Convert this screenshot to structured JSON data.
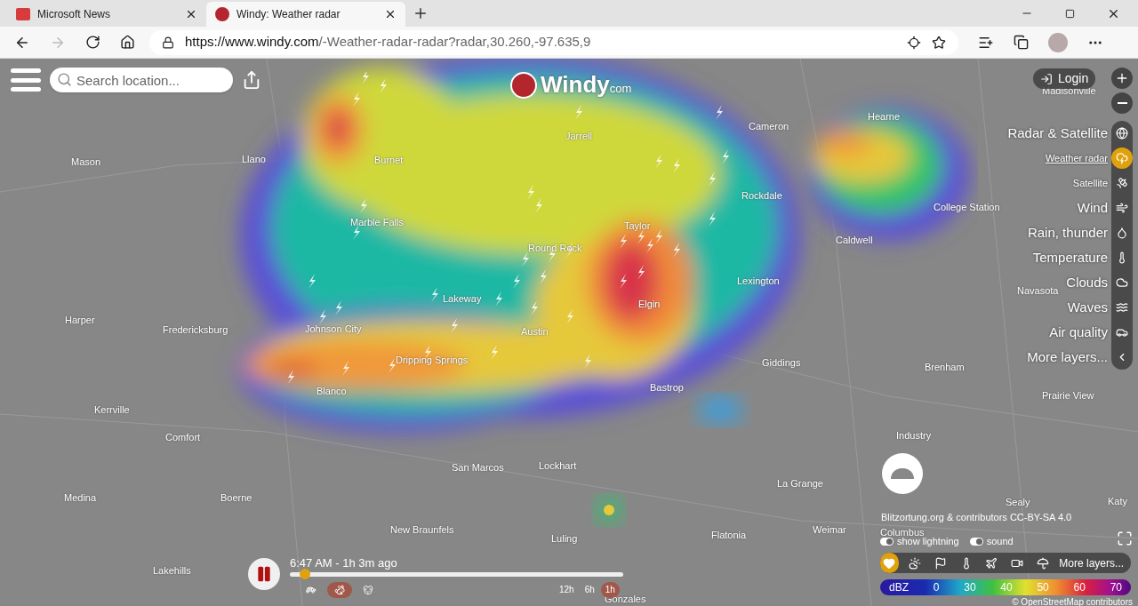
{
  "browser": {
    "tabs": [
      {
        "title": "Microsoft News",
        "selected": false
      },
      {
        "title": "Windy: Weather radar",
        "selected": true
      }
    ],
    "url_host": "https://www.windy.com",
    "url_path": "/-Weather-radar-radar?radar,30.260,-97.635,9",
    "forward_disabled": true
  },
  "search": {
    "placeholder": "Search location..."
  },
  "logo": {
    "brand": "Windy",
    "suffix": "com"
  },
  "login": "Login",
  "layers": [
    {
      "label": "Radar & Satellite",
      "kind": "major",
      "selected": false
    },
    {
      "label": "Weather radar",
      "kind": "minor",
      "selected": true
    },
    {
      "label": "Satellite",
      "kind": "minor",
      "selected": false
    },
    {
      "label": "Wind",
      "kind": "major",
      "selected": false
    },
    {
      "label": "Rain, thunder",
      "kind": "major",
      "selected": false
    },
    {
      "label": "Temperature",
      "kind": "major",
      "selected": false
    },
    {
      "label": "Clouds",
      "kind": "major",
      "selected": false
    },
    {
      "label": "Waves",
      "kind": "major",
      "selected": false
    },
    {
      "label": "Air quality",
      "kind": "major",
      "selected": false
    },
    {
      "label": "More layers...",
      "kind": "major",
      "selected": false
    }
  ],
  "cities": [
    "Madisonville",
    "Mason",
    "Llano",
    "Burnet",
    "Jarrell",
    "Cameron",
    "Hearne",
    "Marble Falls",
    "Round Rock",
    "Taylor",
    "Rockdale",
    "College Station",
    "Caldwell",
    "Lakeway",
    "Lexington",
    "Navasota",
    "Harper",
    "Fredericksburg",
    "Johnson City",
    "Austin",
    "Elgin",
    "Dripping Springs",
    "Giddings",
    "Brenham",
    "Blanco",
    "Bastrop",
    "Prairie View",
    "Kerrville",
    "Comfort",
    "Industry",
    "San Marcos",
    "Lockhart",
    "La Grange",
    "Medina",
    "Boerne",
    "Sealy",
    "Katy",
    "New Braunfels",
    "Luling",
    "Flatonia",
    "Weimar",
    "Columbus",
    "Lakehills",
    "Gonzales"
  ],
  "attribution": "Blitzortung.org & contributors CC-BY-SA 4.0",
  "toggles": [
    {
      "label": "show lightning",
      "on": true
    },
    {
      "label": "sound",
      "on": true
    }
  ],
  "overlay_buttons": [
    {
      "selected": true
    },
    {
      "selected": false
    },
    {
      "selected": false
    },
    {
      "selected": false
    },
    {
      "selected": false
    },
    {
      "selected": false
    },
    {
      "selected": false
    }
  ],
  "more_layers": "More layers...",
  "legend": {
    "unit": "dBZ",
    "labels": [
      "0",
      "30",
      "40",
      "50",
      "60",
      "70"
    ]
  },
  "osm": "© OpenStreetMap contributors",
  "timeline": {
    "playing": true,
    "time": "6:47 AM - 1h 3m ago",
    "level": 0.03,
    "speeds": [
      {
        "selected": false
      },
      {
        "selected": true
      },
      {
        "selected": false
      }
    ],
    "ranges": [
      {
        "label": "12h",
        "selected": false
      },
      {
        "label": "6h",
        "selected": false
      },
      {
        "label": "1h",
        "selected": true
      }
    ]
  }
}
